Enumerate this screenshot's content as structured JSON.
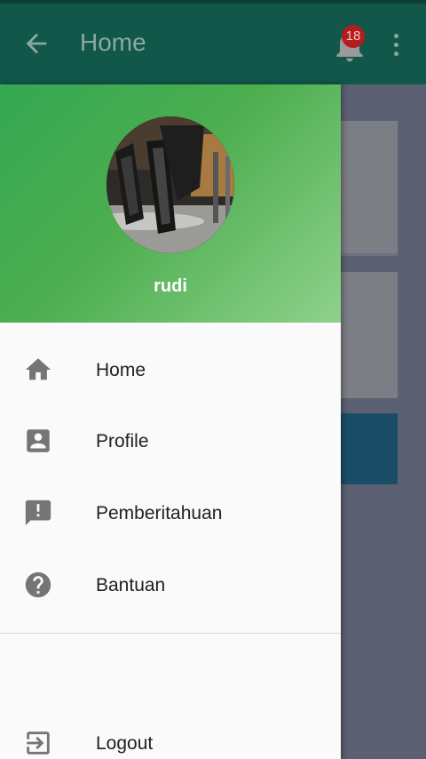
{
  "appbar": {
    "title": "Home",
    "notification_count": "18",
    "back_icon": "arrow-back-icon",
    "bell_icon": "bell-icon",
    "overflow_icon": "overflow-menu-icon"
  },
  "drawer": {
    "username": "rudi",
    "items": [
      {
        "label": "Home",
        "icon": "home-icon"
      },
      {
        "label": "Profile",
        "icon": "profile-icon"
      },
      {
        "label": "Pemberitahuan",
        "icon": "announcement-icon"
      },
      {
        "label": "Bantuan",
        "icon": "help-icon"
      }
    ],
    "logout": {
      "label": "Logout",
      "icon": "logout-icon"
    }
  },
  "colors": {
    "appbar": "#11574a",
    "header_gradient_start": "#34a853",
    "header_gradient_end": "#8fd18c",
    "badge": "#b51c1c",
    "scrim": "#5b6072"
  }
}
